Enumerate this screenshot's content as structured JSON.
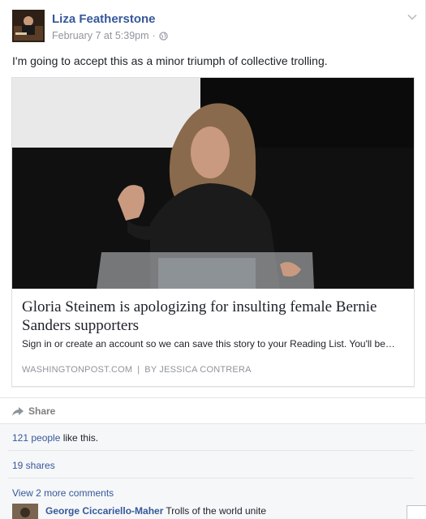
{
  "post": {
    "author": "Liza Featherstone",
    "timestamp": "February 7 at 5:39pm",
    "separator": "·",
    "audience_icon": "globe-icon",
    "menu_icon": "chevron-down-icon",
    "text": "I'm going to accept this as a minor triumph of collective trolling."
  },
  "link_card": {
    "title": "Gloria Steinem is apologizing for insulting female Bernie Sanders supporters",
    "description": "Sign in or create an account so we can save this story to your Reading List. You'll be…",
    "domain": "WASHINGTONPOST.COM",
    "divider": "|",
    "byline": "BY JESSICA CONTRERA"
  },
  "actions": {
    "share_label": "Share",
    "share_icon": "share-arrow-icon"
  },
  "ufi": {
    "likes_link": "121 people",
    "likes_suffix": " like this.",
    "shares": "19 shares",
    "view_more": "View 2 more comments"
  },
  "comment": {
    "author": "George Ciccariello-Maher",
    "text": "Trolls of the world unite"
  },
  "colors": {
    "link_blue": "#365899",
    "meta_gray": "#90949c",
    "ufi_background": "#f6f7f9"
  }
}
